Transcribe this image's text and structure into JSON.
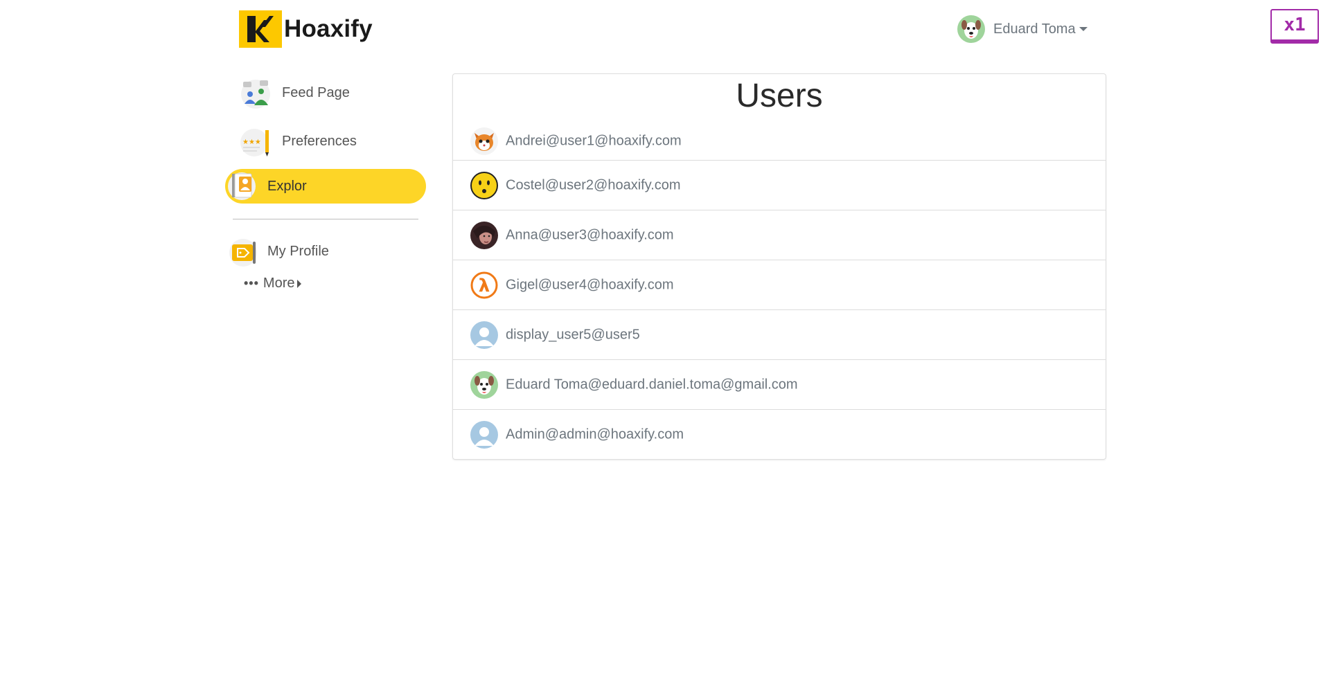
{
  "header": {
    "brand": "Hoaxify",
    "user_name": "Eduard Toma",
    "zoom_badge": "x1"
  },
  "sidebar": {
    "items": [
      {
        "label": "Feed Page",
        "icon": "feed-icon"
      },
      {
        "label": "Preferences",
        "icon": "preferences-icon"
      },
      {
        "label": "Explor",
        "icon": "explore-icon",
        "active": true
      }
    ],
    "profile": {
      "label": "My Profile",
      "icon": "profile-tag-icon"
    },
    "more_label": "More"
  },
  "users_card": {
    "title": "Users",
    "rows": [
      {
        "text": "Andrei@user1@hoaxify.com",
        "avatar": "cat-avatar"
      },
      {
        "text": "Costel@user2@hoaxify.com",
        "avatar": "smiley-avatar"
      },
      {
        "text": "Anna@user3@hoaxify.com",
        "avatar": "photo-avatar"
      },
      {
        "text": "Gigel@user4@hoaxify.com",
        "avatar": "lambda-avatar"
      },
      {
        "text": "display_user5@user5",
        "avatar": "default-avatar"
      },
      {
        "text": "Eduard Toma@eduard.daniel.toma@gmail.com",
        "avatar": "dog-avatar"
      },
      {
        "text": "Admin@admin@hoaxify.com",
        "avatar": "default-avatar"
      }
    ]
  },
  "colors": {
    "accent": "#fdd527",
    "text": "#6c757d",
    "badge": "#a22ba8"
  }
}
